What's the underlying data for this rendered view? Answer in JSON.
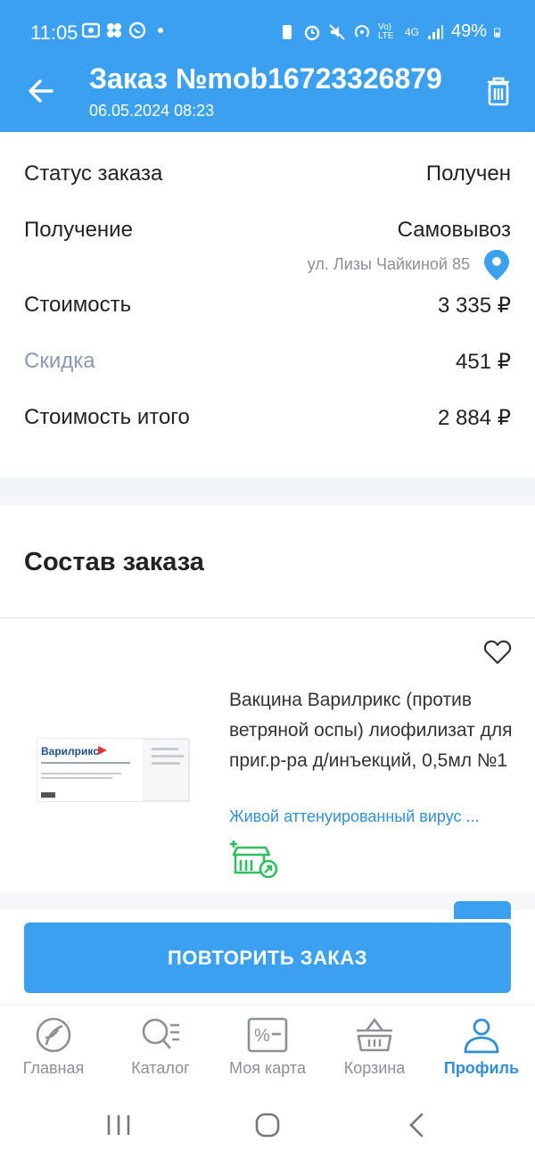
{
  "status_bar": {
    "time": "11:05",
    "network": "4G",
    "volte": "Vo) LTE",
    "battery": "49%"
  },
  "app_bar": {
    "title": "Заказ №mob16723326879",
    "subtitle": "06.05.2024 08:23"
  },
  "order_info": {
    "status_label": "Статус заказа",
    "status_value": "Получен",
    "delivery_label": "Получение",
    "delivery_value": "Самовывоз",
    "address": "ул. Лизы Чайкиной 85",
    "cost_label": "Стоимость",
    "cost_value": "3 335 ₽",
    "discount_label": "Скидка",
    "discount_value": "451 ₽",
    "total_label": "Стоимость итого",
    "total_value": "2 884 ₽"
  },
  "composition": {
    "title": "Состав заказа",
    "product": {
      "name": "Вакцина Варилрикс (против ветряной оспы) лиофилизат для приг.р-ра д/инъекций, 0,5мл №1",
      "description": "Живой аттенуированный вирус ...",
      "image_brand": "Варилрикс"
    }
  },
  "repeat_button": "ПОВТОРИТЬ ЗАКАЗ",
  "bottom_nav": [
    {
      "label": "Главная",
      "icon": "home-icon"
    },
    {
      "label": "Каталог",
      "icon": "catalog-icon"
    },
    {
      "label": "Моя карта",
      "icon": "card-icon"
    },
    {
      "label": "Корзина",
      "icon": "basket-icon"
    },
    {
      "label": "Профиль",
      "icon": "profile-icon",
      "active": true
    }
  ],
  "colors": {
    "primary": "#3aa0ef",
    "link": "#2f8fd8",
    "store_icon": "#2fbf5f"
  }
}
